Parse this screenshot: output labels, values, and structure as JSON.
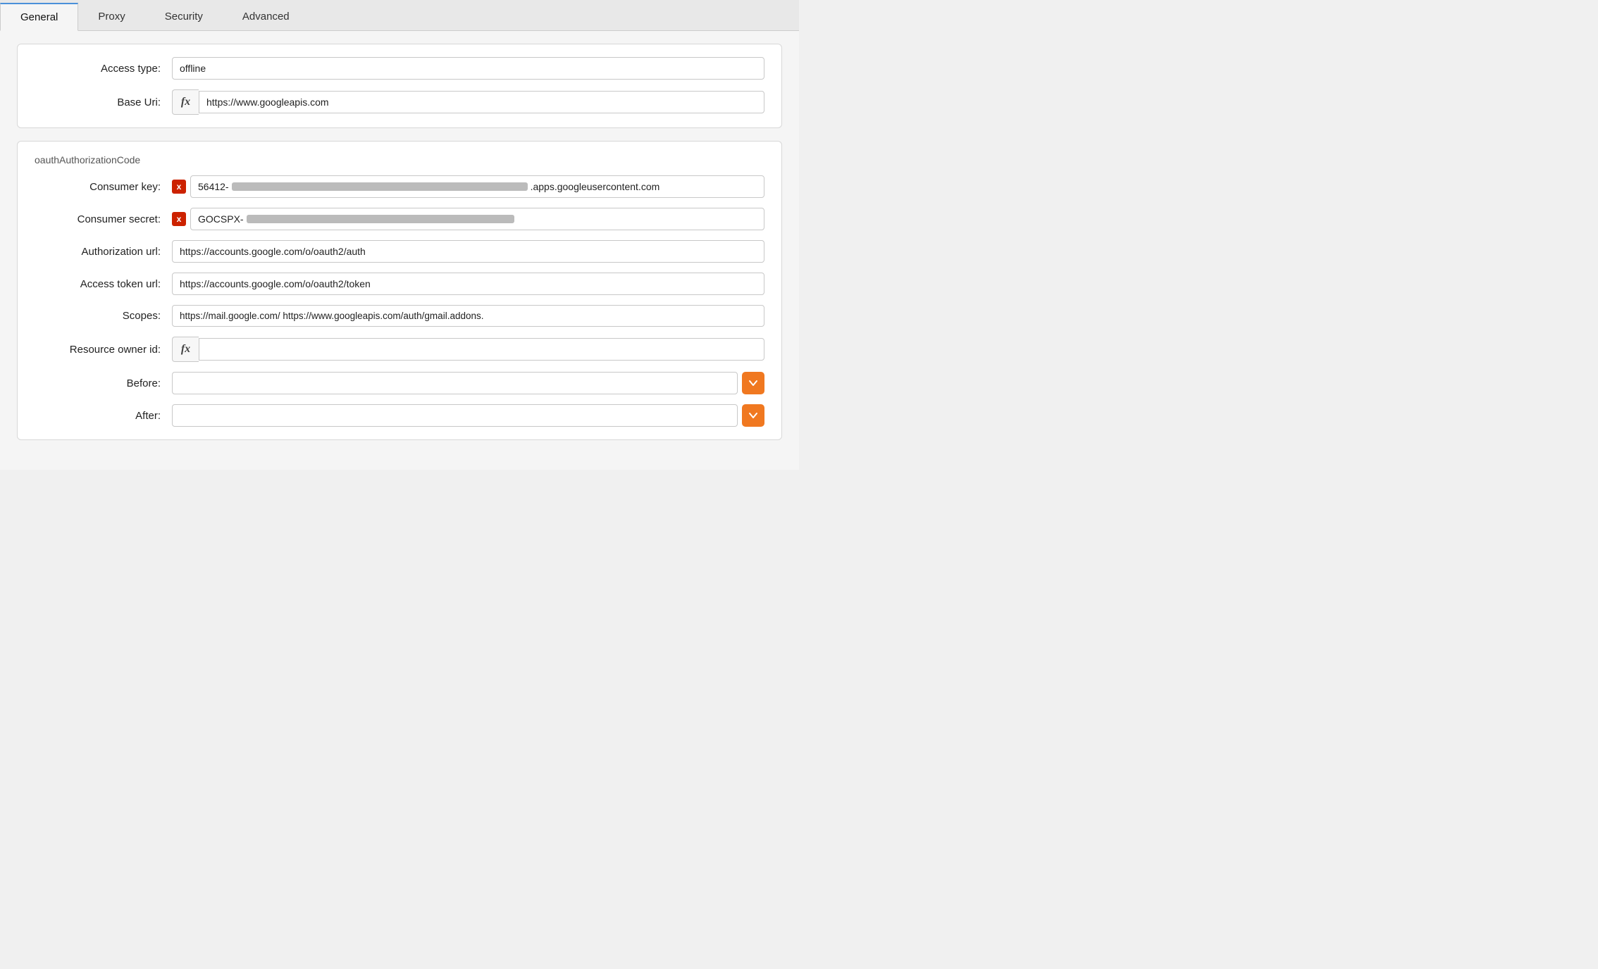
{
  "tabs": [
    {
      "label": "General",
      "active": true
    },
    {
      "label": "Proxy",
      "active": false
    },
    {
      "label": "Security",
      "active": false
    },
    {
      "label": "Advanced",
      "active": false
    }
  ],
  "general": {
    "access_type_label": "Access type:",
    "access_type_value": "offline",
    "base_uri_label": "Base Uri:",
    "base_uri_value": "https://www.googleapis.com",
    "fx_symbol": "fx"
  },
  "oauth": {
    "section_title": "oauthAuthorizationCode",
    "consumer_key_label": "Consumer key:",
    "consumer_key_prefix": "56412-",
    "consumer_key_suffix": ".apps.googleusercontent.com",
    "consumer_secret_label": "Consumer secret:",
    "consumer_secret_prefix": "GOCSPX-",
    "authorization_url_label": "Authorization url:",
    "authorization_url_value": "https://accounts.google.com/o/oauth2/auth",
    "access_token_url_label": "Access token url:",
    "access_token_url_value": "https://accounts.google.com/o/oauth2/token",
    "scopes_label": "Scopes:",
    "scopes_value": "https://mail.google.com/ https://www.googleapis.com/auth/gmail.addons.",
    "resource_owner_id_label": "Resource owner id:",
    "resource_owner_id_value": "",
    "before_label": "Before:",
    "before_value": "",
    "after_label": "After:",
    "after_value": "",
    "fx_symbol": "fx",
    "error_symbol": "x"
  }
}
